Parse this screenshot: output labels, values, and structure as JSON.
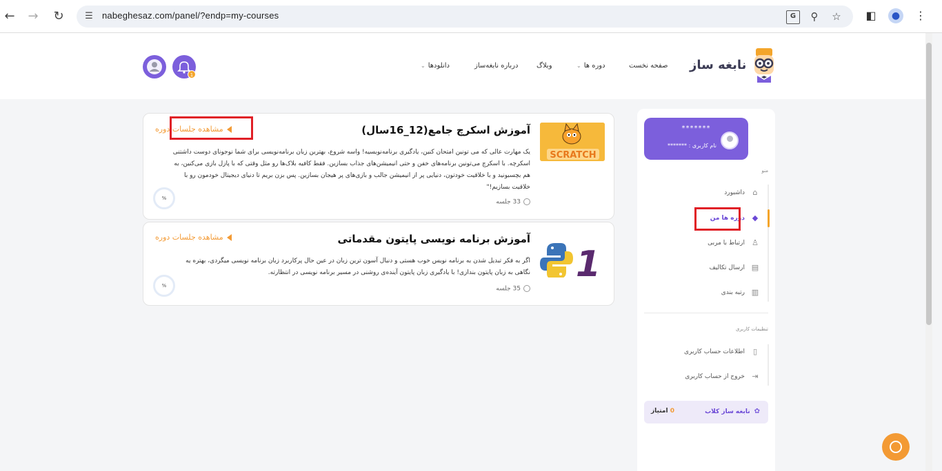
{
  "browser": {
    "url": "nabeghesaz.com/panel/?endp=my-courses",
    "back": "←",
    "forward": "→",
    "reload": "↻",
    "site_info": "☰",
    "zoom": "⚲",
    "bookmark": "☆",
    "sidepanel": "◧",
    "menu": "⋮",
    "profile": "●",
    "translate": "G"
  },
  "header": {
    "logo_text": "نابغه ساز",
    "nav": [
      {
        "label": "صفحه نخست",
        "has_caret": false
      },
      {
        "label": "دوره ها",
        "has_caret": true
      },
      {
        "label": "وبلاگ",
        "has_caret": false
      },
      {
        "label": "درباره نابغه‌ساز",
        "has_caret": false
      },
      {
        "label": "دانلودها",
        "has_caret": true
      }
    ],
    "caret": "⌄",
    "notification_count": "1"
  },
  "courses": [
    {
      "title": "آموزش اسکرچ جامع(12_16سال)",
      "description": "یک مهارت عالی که می تونین امتحان کنین، یادگیری برنامه‌نویسیه! واسه شروع، بهترین زبان برنامه‌نویسی برای شما نوجونای دوست داشتنی اسکرچه. با اسکرچ می‌تونین برنامه‌های خفن و حتی انیمیشن‌های جذاب بسازین. فقط کافیه بلاک‌ها رو مثل وقتی که با پازل بازی می‌کنین، به هم بچسبونید و با خلاقیت خودتون، دنیایی پر از انیمیشن جالب و بازی‌های پر هیجان بسازین. پس بزن بریم تا دنیای دیجیتال خودمون رو با خلاقیت بسازیم!\"",
      "sessions": "33 جلسه",
      "view_label": "مشاهده جلسات دوره",
      "progress": "%",
      "thumb_text": "SCRATCH"
    },
    {
      "title": "آموزش برنامه نویسی پایتون مقدماتی",
      "description": "اگر به فکر تبدیل شدن به برنامه نویس خوب هستی و دنبال آسون ترین زبان در عین حال پرکاربرد زبان برنامه نویسی میگردی، بهتره یه نگاهی به زبان پایتون بندازی! با یادگیری زبان پایتون آینده‌ی روشنی در مسیر برنامه نویسی در انتظارته.",
      "sessions": "35 جلسه",
      "view_label": "مشاهده جلسات دوره",
      "progress": "%",
      "thumb_text": "1"
    }
  ],
  "sidebar": {
    "user_name": "*******",
    "user_label": "نام کاربری : *******",
    "menu_heading": "منو",
    "menu": [
      {
        "label": "داشبورد",
        "icon": "⌂",
        "active": false
      },
      {
        "label": "دوره ها من",
        "icon": "◆",
        "active": true
      },
      {
        "label": "ارتباط با مربی",
        "icon": "♙",
        "active": false
      },
      {
        "label": "ارسال تکالیف",
        "icon": "▤",
        "active": false
      },
      {
        "label": "رتبه بندی",
        "icon": "▥",
        "active": false
      }
    ],
    "settings_heading": "تنظیمات کاربری",
    "settings": [
      {
        "label": "اطلاعات حساب کاربری",
        "icon": "▯"
      },
      {
        "label": "خروج از حساب کاربری",
        "icon": "⇥"
      }
    ],
    "club_label": "نابغه ساز کلاب",
    "club_icon": "✿",
    "club_points_num": "0",
    "club_points_text": "امتیاز"
  },
  "colors": {
    "accent_purple": "#7c5fdc",
    "accent_orange": "#f39a34",
    "highlight_red": "#e01f26"
  }
}
